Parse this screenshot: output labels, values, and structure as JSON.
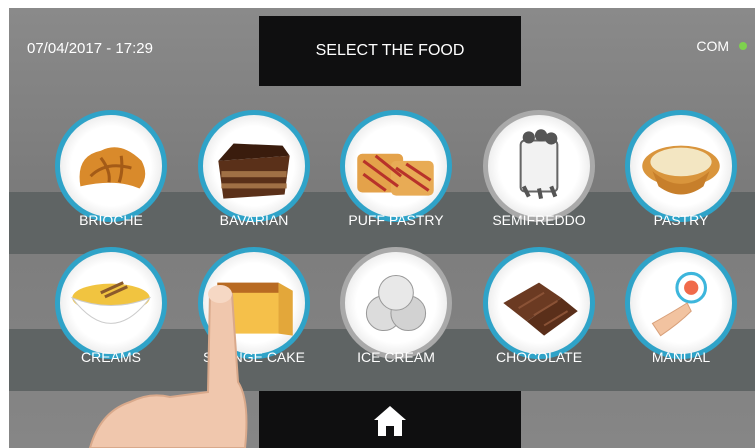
{
  "header": {
    "datetime": "07/04/2017 - 17:29",
    "title": "SELECT THE FOOD",
    "status_label": "COM",
    "status_color": "#7ed24e"
  },
  "foods_row1": [
    {
      "label": "BRIOCHE",
      "icon": "croissant-icon"
    },
    {
      "label": "BAVARIAN",
      "icon": "cake-slice-icon"
    },
    {
      "label": "PUFF PASTRY",
      "icon": "puff-pastry-icon"
    },
    {
      "label": "SEMIFREDDO",
      "icon": "semifreddo-icon"
    },
    {
      "label": "PASTRY",
      "icon": "tart-icon"
    }
  ],
  "foods_row2": [
    {
      "label": "CREAMS",
      "icon": "cream-bowl-icon"
    },
    {
      "label": "SPONGE CAKE",
      "icon": "sponge-cake-icon"
    },
    {
      "label": "ICE CREAM",
      "icon": "ice-cream-icon"
    },
    {
      "label": "CHOCOLATE",
      "icon": "chocolate-icon"
    },
    {
      "label": "MANUAL",
      "icon": "manual-touch-icon"
    }
  ],
  "footer": {
    "home_icon": "home-icon"
  },
  "colors": {
    "accent": "#2fa3c8",
    "band": "#5c6262",
    "box": "#0f0f10"
  }
}
